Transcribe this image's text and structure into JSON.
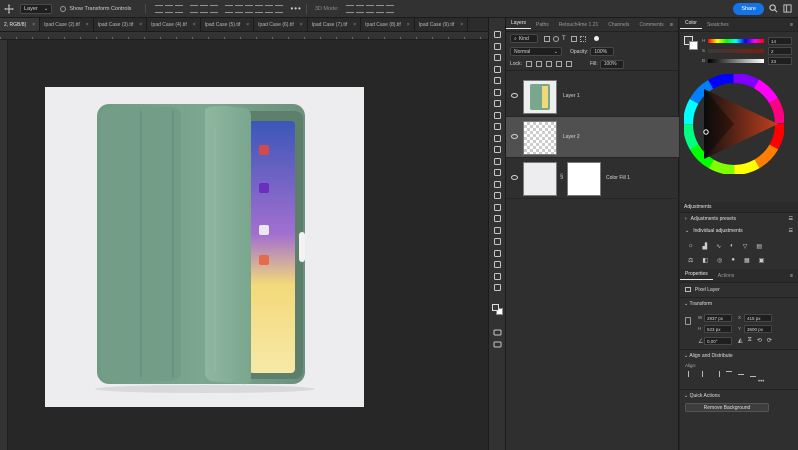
{
  "options_bar": {
    "layer_select": "Layer",
    "show_transform_label": "Show Transform Controls",
    "mode_3d_label": "3D Mode:",
    "share_label": "Share"
  },
  "tabs": [
    {
      "label": "2, RGB/8)",
      "active": true
    },
    {
      "label": "Ipad Case (2).tif",
      "active": false
    },
    {
      "label": "Ipad Case (3).tif",
      "active": false
    },
    {
      "label": "Ipad Case (4).tif",
      "active": false
    },
    {
      "label": "Ipad Case (5).tif",
      "active": false
    },
    {
      "label": "Ipad Case (6).tif",
      "active": false
    },
    {
      "label": "Ipad Case (7).tif",
      "active": false
    },
    {
      "label": "Ipad Case (8).tif",
      "active": false
    },
    {
      "label": "Ipad Case (9).tif",
      "active": false
    }
  ],
  "layers_panel": {
    "tabs": [
      "Layers",
      "Paths",
      "Retouch4me 1.21",
      "Channels",
      "Comments"
    ],
    "kind_label": "Kind",
    "blend_mode": "Normal",
    "opacity_label": "Opacity:",
    "opacity_value": "100%",
    "lock_label": "Lock:",
    "fill_label": "Fill:",
    "fill_value": "100%",
    "layers": [
      {
        "name": "Layer 1",
        "selected": false
      },
      {
        "name": "Layer 2",
        "selected": true
      },
      {
        "name": "Color Fill 1",
        "selected": false
      }
    ]
  },
  "color_panel": {
    "tabs": [
      "Color",
      "Swatches"
    ],
    "h_label": "H",
    "h_value": "14",
    "s_label": "S",
    "s_value": "2",
    "b_label": "B",
    "b_value": "23"
  },
  "adjustments": {
    "title": "Adjustments",
    "presets_label": "Adjustments presets",
    "individual_label": "Individual adjustments"
  },
  "properties": {
    "tabs": [
      "Properties",
      "Actions"
    ],
    "kind_label": "Pixel Layer",
    "transform_label": "Transform",
    "w_label": "W",
    "w_value": "2937 px",
    "h_label": "H",
    "h_value": "523 px",
    "x_label": "X",
    "x_value": "415 px",
    "y_label": "Y",
    "y_value": "3600 px",
    "angle_value": "0,00°",
    "align_label": "Align and Distribute",
    "align_sub": "Align:",
    "quick_actions_label": "Quick Actions",
    "remove_bg_label": "Remove Background"
  },
  "colors": {
    "accent": "#1473e6",
    "case_green": "#7fa690",
    "selected_layer": "#505050"
  }
}
